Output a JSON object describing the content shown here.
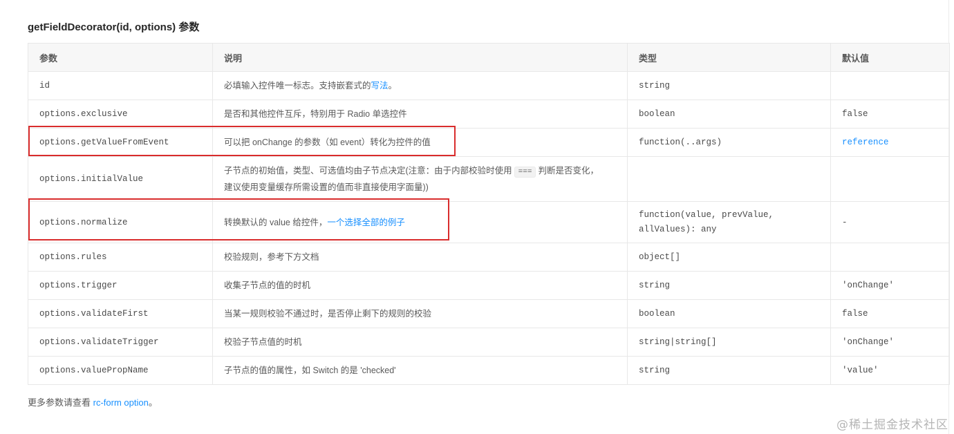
{
  "section": {
    "title": "getFieldDecorator(id, options) 参数"
  },
  "table": {
    "headers": [
      "参数",
      "说明",
      "类型",
      "默认值"
    ],
    "rows": [
      {
        "param": "id",
        "desc_pre": "必填输入控件唯一标志。支持嵌套式的",
        "desc_link": "写法",
        "desc_post": "。",
        "type": "string",
        "default": ""
      },
      {
        "param": "options.exclusive",
        "desc": "是否和其他控件互斥，特别用于 Radio 单选控件",
        "type": "boolean",
        "default": "false"
      },
      {
        "param": "options.getValueFromEvent",
        "desc": "可以把 onChange 的参数（如 event）转化为控件的值",
        "type": "function(..args)",
        "default": "reference"
      },
      {
        "param": "options.initialValue",
        "desc_pre": "子节点的初始值，类型、可选值均由子节点决定(注意：由于内部校验时使用",
        "desc_code": "===",
        "desc_post": "判断是否变化，",
        "desc_line2": "建议使用变量缓存所需设置的值而非直接使用字面量))",
        "type": "",
        "default": ""
      },
      {
        "param": "options.normalize",
        "desc_pre": "转换默认的 value 给控件，",
        "desc_link": "一个选择全部的例子",
        "type_line1": "function(value, prevValue,",
        "type_line2": "allValues): any",
        "default": "-"
      },
      {
        "param": "options.rules",
        "desc": "校验规则，参考下方文档",
        "type": "object[]",
        "default": ""
      },
      {
        "param": "options.trigger",
        "desc": "收集子节点的值的时机",
        "type": "string",
        "default": "'onChange'"
      },
      {
        "param": "options.validateFirst",
        "desc": "当某一规则校验不通过时，是否停止剩下的规则的校验",
        "type": "boolean",
        "default": "false"
      },
      {
        "param": "options.validateTrigger",
        "desc": "校验子节点值的时机",
        "type": "string|string[]",
        "default": "'onChange'"
      },
      {
        "param": "options.valuePropName",
        "desc": "子节点的值的属性，如 Switch 的是 'checked'",
        "type": "string",
        "default": "'value'"
      }
    ]
  },
  "footer": {
    "pre": "更多参数请查看 ",
    "link": "rc-form option",
    "post": "。"
  },
  "watermark": "@稀土掘金技术社区",
  "colors": {
    "link": "#1890ff",
    "highlight_box": "#d92c2c",
    "header_bg": "#f7f7f7",
    "border": "#e8e8e8"
  }
}
